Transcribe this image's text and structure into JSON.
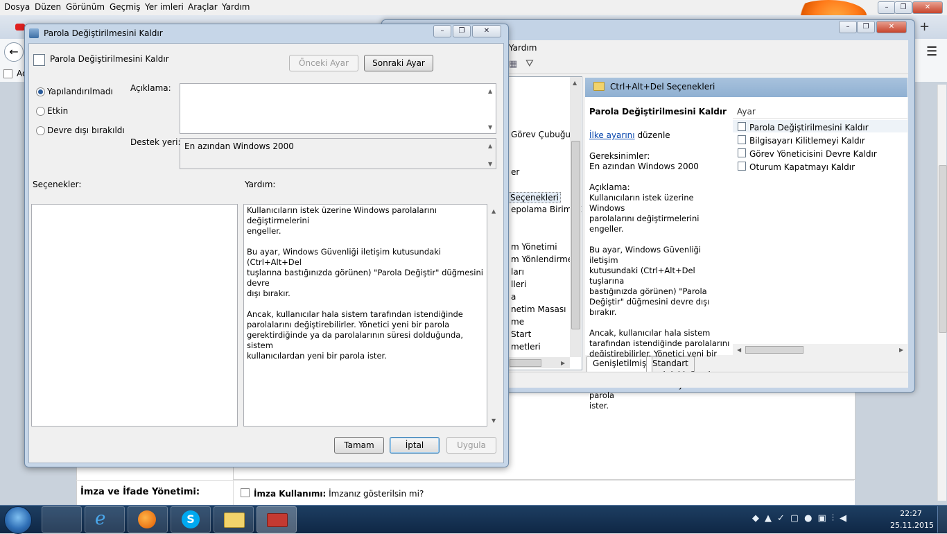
{
  "firefox": {
    "menu": [
      "Dosya",
      "Düzen",
      "Görünüm",
      "Geçmiş",
      "Yer imleri",
      "Araçlar",
      "Yardım"
    ],
    "bookmark_label": "Ad"
  },
  "page": {
    "section_title": "İmza ve İfade Yönetimi:",
    "signature_option_bold": "İmza Kullanımı:",
    "signature_option_text": "İmzanız gösterilsin mi?"
  },
  "gpe": {
    "menu_help": "Yardım",
    "tree_items": [
      "Görev Çubuğu",
      "er",
      "Seçenekleri",
      "epolama Birimi E",
      "m Yönetimi",
      "m Yönlendirme",
      "ları",
      "lleri",
      "a",
      "netim Masası",
      "me",
      "Start",
      "metleri"
    ],
    "detail_header": "Ctrl+Alt+Del Seçenekleri",
    "detail_title": "Parola Değiştirilmesini Kaldır",
    "edit_link": "İlke ayarını",
    "edit_suffix": "düzenle",
    "requirements_label": "Gereksinimler:",
    "requirements_value": "En azından Windows 2000",
    "description_label": "Açıklama:",
    "description_text": "Kullanıcıların istek üzerine Windows\nparolalarını değiştirmelerini engeller.\n\nBu ayar, Windows Güvenliği iletişim\nkutusundaki (Ctrl+Alt+Del tuşlarına\nbastığınızda görünen) \"Parola\nDeğiştir\" düğmesini devre dışı bırakır.\n\nAncak, kullanıcılar hala sistem\ntarafından istendiğinde parolalarını\ndeğiştirebilirler. Yönetici yeni bir\nparola gerektirdiğinde ya da\nparolalarının süresi dolduğunda,\nsistem kullanıcılardan yeni bir parola\nister.",
    "column_header": "Ayar",
    "policies": [
      "Parola Değiştirilmesini Kaldır",
      "Bilgisayarı Kilitlemeyi Kaldır",
      "Görev Yöneticisini Devre Kaldır",
      "Oturum Kapatmayı Kaldır"
    ],
    "tab_extended": "Genişletilmiş",
    "tab_standard": "Standart"
  },
  "dialog": {
    "window_title": "Parola Değiştirilmesini Kaldır",
    "header_title": "Parola Değiştirilmesini Kaldır",
    "prev_button": "Önceki Ayar",
    "next_button": "Sonraki Ayar",
    "radio_not_configured": "Yapılandırılmadı",
    "radio_enabled": "Etkin",
    "radio_disabled": "Devre dışı bırakıldı",
    "comment_label": "Açıklama:",
    "supported_label": "Destek yeri:",
    "supported_value": "En azından Windows 2000",
    "options_label": "Seçenekler:",
    "help_label": "Yardım:",
    "help_text": "Kullanıcıların istek üzerine Windows parolalarını değiştirmelerini\nengeller.\n\nBu ayar, Windows Güvenliği iletişim kutusundaki (Ctrl+Alt+Del\ntuşlarına bastığınızda görünen) \"Parola Değiştir\" düğmesini devre\ndışı bırakır.\n\nAncak, kullanıcılar hala sistem tarafından istendiğinde\nparolalarını değiştirebilirler. Yönetici yeni bir parola\ngerektirdiğinde ya da parolalarının süresi dolduğunda, sistem\nkullanıcılardan yeni bir parola ister.",
    "ok_button": "Tamam",
    "cancel_button": "İptal",
    "apply_button": "Uygula",
    "selected_radio": "not_configured"
  },
  "taskbar": {
    "time": "22:27",
    "date": "25.11.2015"
  },
  "colors": {
    "taskbar": "#163356",
    "link": "#0645ad",
    "gpe_header": "#9bb8d8"
  }
}
